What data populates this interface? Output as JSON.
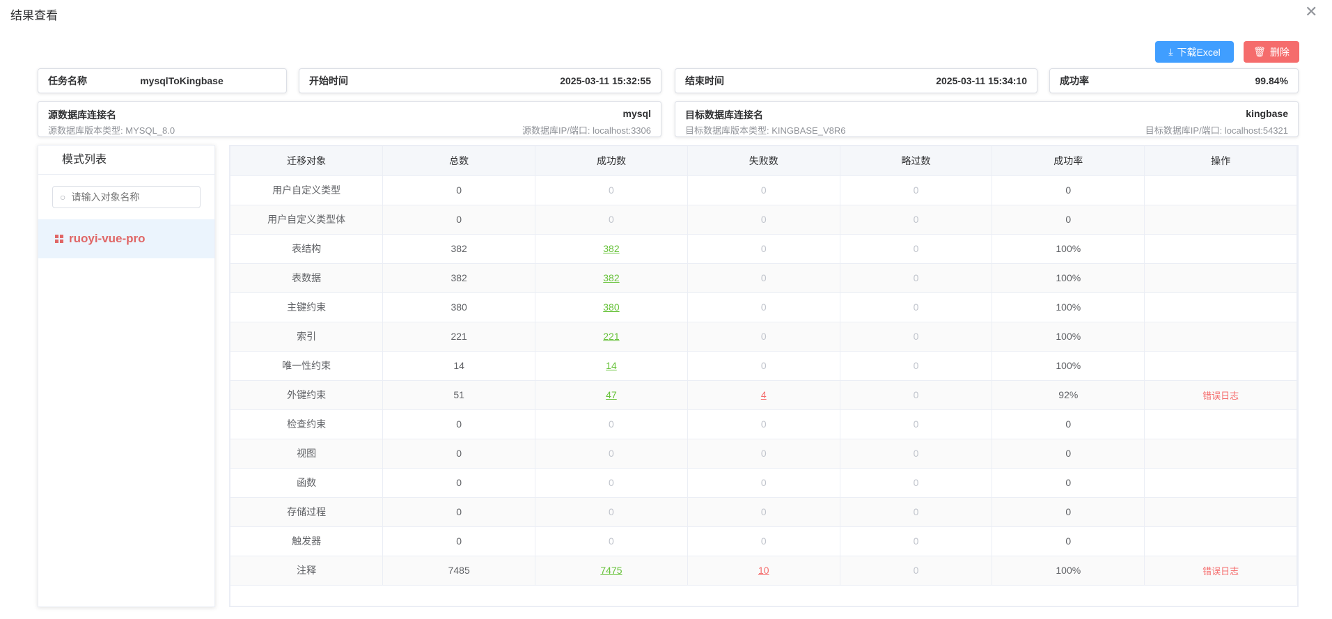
{
  "dialog": {
    "title": "结果查看",
    "close": "✕"
  },
  "toolbar": {
    "download": "下载Excel",
    "delete": "删除"
  },
  "info": {
    "task_label": "任务名称",
    "task_value": "mysqlToKingbase",
    "start_label": "开始时间",
    "start_value": "2025-03-11 15:32:55",
    "end_label": "结束时间",
    "end_value": "2025-03-11 15:34:10",
    "rate_label": "成功率",
    "rate_value": "99.84%",
    "src_label": "源数据库连接名",
    "src_value": "mysql",
    "src_ver_label": "源数据库版本类型:",
    "src_ver": "MYSQL_8.0",
    "src_ip_label": "源数据库IP/端口:",
    "src_ip": "localhost:3306",
    "dst_label": "目标数据库连接名",
    "dst_value": "kingbase",
    "dst_ver_label": "目标数据库版本类型:",
    "dst_ver": "KINGBASE_V8R6",
    "dst_ip_label": "目标数据库IP/端口:",
    "dst_ip": "localhost:54321"
  },
  "sidebar": {
    "title": "模式列表",
    "search_placeholder": "请输入对象名称",
    "schemas": [
      "ruoyi-vue-pro"
    ]
  },
  "table": {
    "headers": [
      "迁移对象",
      "总数",
      "成功数",
      "失败数",
      "略过数",
      "成功率",
      "操作"
    ],
    "rows": [
      [
        "用户自定义类型",
        "0",
        "0",
        "0",
        "0",
        "0",
        ""
      ],
      [
        "用户自定义类型体",
        "0",
        "0",
        "0",
        "0",
        "0",
        ""
      ],
      [
        "表结构",
        "382",
        "382",
        "0",
        "0",
        "100%",
        ""
      ],
      [
        "表数据",
        "382",
        "382",
        "0",
        "0",
        "100%",
        ""
      ],
      [
        "主键约束",
        "380",
        "380",
        "0",
        "0",
        "100%",
        ""
      ],
      [
        "索引",
        "221",
        "221",
        "0",
        "0",
        "100%",
        ""
      ],
      [
        "唯一性约束",
        "14",
        "14",
        "0",
        "0",
        "100%",
        ""
      ],
      [
        "外键约束",
        "51",
        "47",
        "4",
        "0",
        "92%",
        "错误日志"
      ],
      [
        "检查约束",
        "0",
        "0",
        "0",
        "0",
        "0",
        ""
      ],
      [
        "视图",
        "0",
        "0",
        "0",
        "0",
        "0",
        ""
      ],
      [
        "函数",
        "0",
        "0",
        "0",
        "0",
        "0",
        ""
      ],
      [
        "存储过程",
        "0",
        "0",
        "0",
        "0",
        "0",
        ""
      ],
      [
        "触发器",
        "0",
        "0",
        "0",
        "0",
        "0",
        ""
      ],
      [
        "注释",
        "7485",
        "7475",
        "10",
        "0",
        "100%",
        "错误日志"
      ]
    ]
  },
  "colors": {
    "primary": "#409eff",
    "danger": "#f56c6c",
    "success": "#67c23a"
  }
}
